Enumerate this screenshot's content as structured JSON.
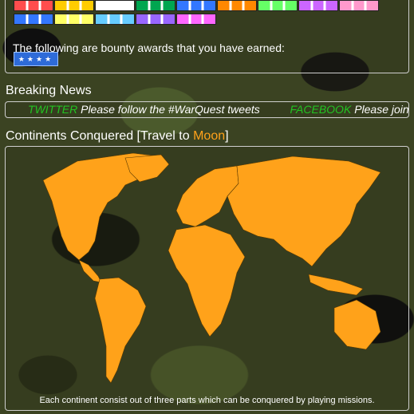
{
  "awards": {
    "bounty_text": "The following are bounty awards that you have earned:",
    "ribbon_rows": [
      [
        "#ff4d4d",
        "#ffcc00",
        "#ffffff",
        "#00a650",
        "#3377ff",
        "#ff8800",
        "#66ff66",
        "#cc66ff",
        "#ff99cc"
      ],
      [
        "#3377ff",
        "#ffff66",
        "#66ccff",
        "#9966ff",
        "#ff66ff"
      ]
    ]
  },
  "news": {
    "title": "Breaking News",
    "items": [
      {
        "brand": "TWITTER",
        "text": "Please follow the #WarQuest tweets"
      },
      {
        "brand": "FACEBOOK",
        "text": "Please join"
      }
    ]
  },
  "continents": {
    "title_prefix": "Continents Conquered [",
    "travel_label": "Travel to ",
    "moon_link": "Moon",
    "title_suffix": "]",
    "caption": "Each continent consist out of three parts which can be conquered by playing missions."
  },
  "colors": {
    "map_fill": "#ffa21a",
    "link_green": "#22c322",
    "moon_orange": "#ffa21a"
  }
}
